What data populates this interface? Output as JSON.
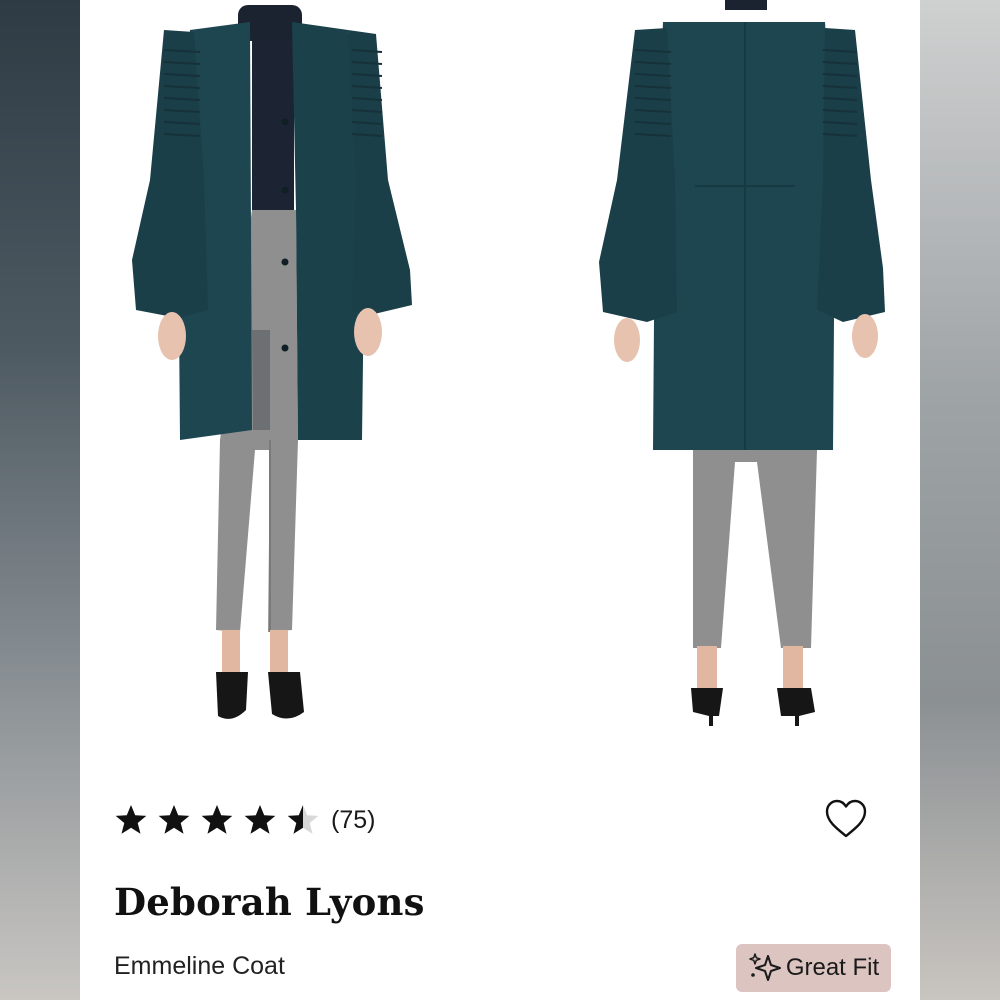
{
  "product": {
    "rating": 4.5,
    "rating_max": 5,
    "review_count": "(75)",
    "brand": "Deborah Lyons",
    "name": "Emmeline Coat",
    "badge": "Great Fit"
  },
  "colors": {
    "coat": "#1e4650",
    "pants": "#8f8f90",
    "badge_bg": "#dcc5c1",
    "star": "#111111"
  },
  "icons": {
    "favorite": "heart-outline-icon",
    "badge": "sparkle-icon",
    "rating": "star-icon"
  }
}
